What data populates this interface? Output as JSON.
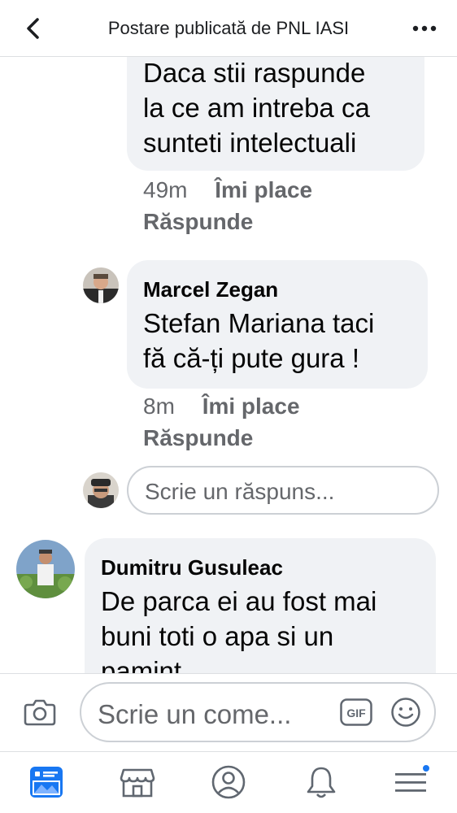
{
  "header": {
    "title": "Postare publicată de PNL IASI",
    "back_icon": "chevron-left-icon",
    "more_icon": "more-horizontal-icon"
  },
  "comments": [
    {
      "author": "",
      "text_lines": [
        "Daca stii raspunde",
        "la ce am intreba ca",
        "sunteti intelectuali"
      ],
      "time": "49m",
      "like_label": "Îmi place",
      "reply_label": "Răspunde"
    },
    {
      "author": "Marcel Zegan",
      "text_lines": [
        "Stefan Mariana taci",
        "fă că-ți pute gura !"
      ],
      "time": "8m",
      "like_label": "Îmi place",
      "reply_label": "Răspunde"
    },
    {
      "author": "Dumitru Gusuleac",
      "text_lines": [
        "De parca ei au fost mai",
        "buni toti o apa si un",
        "pamint"
      ]
    }
  ],
  "reply_box": {
    "placeholder": "Scrie un răspuns..."
  },
  "composer": {
    "placeholder": "Scrie un come...",
    "gif_label": "GIF"
  },
  "bottom_nav": {
    "items": [
      "news-feed-icon",
      "marketplace-icon",
      "profile-icon",
      "notifications-bell-icon",
      "menu-icon"
    ],
    "accent_color": "#1877f2"
  }
}
